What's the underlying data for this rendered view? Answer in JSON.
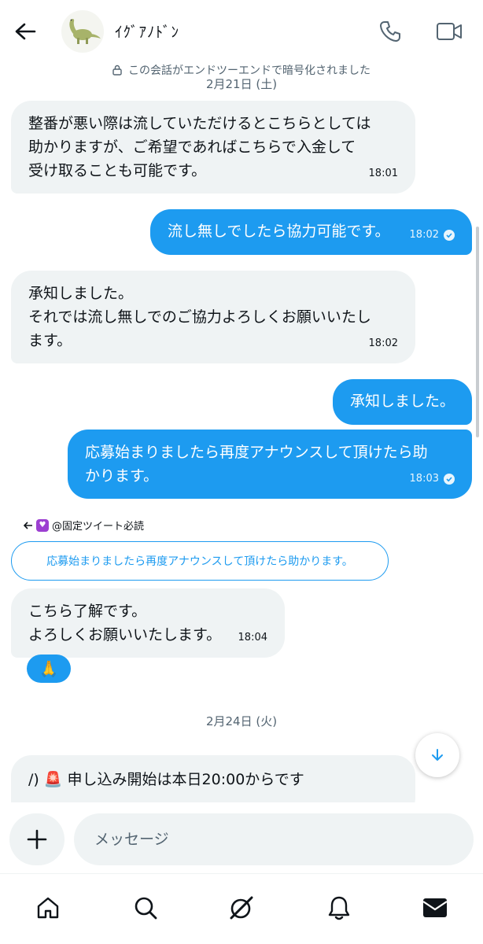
{
  "header": {
    "contact_name": "ｲｸﾞｱﾉﾄﾞﾝ"
  },
  "encryption_notice": "この会話がエンドツーエンドで暗号化されました",
  "dates": {
    "first": "2月21日 (土)",
    "second": "2月24日 (火)"
  },
  "messages": [
    {
      "side": "received",
      "text": "整番が悪い際は流していただけるとこちらとしては\n助かりますが、ご希望であればこちらで入金して\n受け取ることも可能です。",
      "time": "18:01"
    },
    {
      "side": "sent",
      "text": "流し無しでしたら協力可能です。",
      "time": "18:02"
    },
    {
      "side": "received",
      "text": "承知しました。\nそれでは流し無しでのご協力よろしくお願いいたし\nます。",
      "time": "18:02"
    },
    {
      "side": "sent",
      "text": "承知しました。",
      "time": ""
    },
    {
      "side": "sent",
      "text": "応募始まりましたら再度アナウンスして頂けたら助\nかります。",
      "time": "18:03"
    },
    {
      "side": "received",
      "text": "こちら了解です。\nよろしくお願いいたします。",
      "time": "18:04"
    },
    {
      "side": "received",
      "text": "/) 🚨 申し込み開始は本日20:00からです",
      "time": ""
    }
  ],
  "reply": {
    "author": "@固定ツイート必読",
    "quoted_text": "応募始まりましたら再度アナウンスして頂けたら助かります。"
  },
  "reaction_emoji": "🙏",
  "composer": {
    "placeholder": "メッセージ"
  },
  "colors": {
    "accent": "#1d9bf0",
    "received_bubble": "#eff3f4",
    "text": "#0f1419",
    "muted": "#536471"
  },
  "icons": [
    "back-arrow-icon",
    "phone-icon",
    "video-camera-icon",
    "lock-icon",
    "reply-arrow-icon",
    "heart-icon",
    "check-circle-icon",
    "arrow-down-icon",
    "plus-icon",
    "home-icon",
    "search-icon",
    "grok-icon",
    "bell-icon",
    "mail-icon"
  ]
}
